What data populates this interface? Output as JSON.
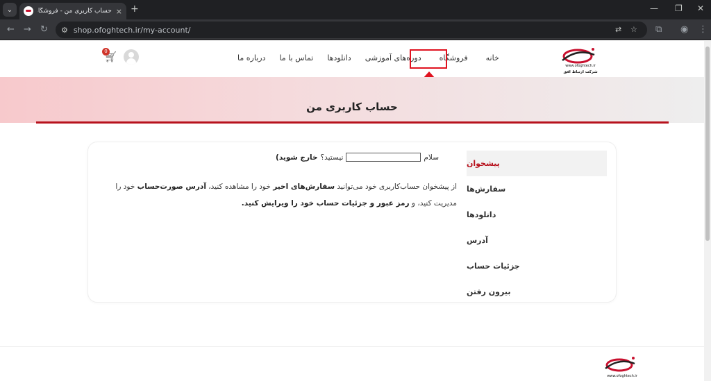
{
  "browser": {
    "tab_title": "حساب کاربری من - فروشگاه اینترنتی ار",
    "tab_close": "×",
    "new_tab": "+",
    "url": "shop.ofoghtech.ir/my-account/",
    "icons": [
      "back-icon",
      "forward-icon",
      "reload-icon",
      "site-info-icon",
      "translate-icon",
      "star-icon",
      "extensions-icon",
      "profile-icon",
      "menu-icon"
    ]
  },
  "header": {
    "nav": [
      {
        "label": "خانه"
      },
      {
        "label": "فروشگاه"
      },
      {
        "label": "دوره‌های آموزشی"
      },
      {
        "label": "دانلودها"
      },
      {
        "label": "تماس با ما"
      },
      {
        "label": "درباره ما"
      }
    ],
    "cart_count": "0",
    "logo_text": "www.ofoghtech.ir",
    "logo_subtext": "شرکت ارتباط افق"
  },
  "hero": {
    "title": "حساب کاربری من"
  },
  "account_menu": [
    {
      "label": "پیشخوان",
      "active": true
    },
    {
      "label": "سفارش‌ها",
      "active": false
    },
    {
      "label": "دانلودها",
      "active": false
    },
    {
      "label": "آدرس",
      "active": false
    },
    {
      "label": "جزئیات حساب",
      "active": false
    },
    {
      "label": "بیرون رفتن",
      "active": false
    }
  ],
  "dashboard": {
    "hello": "سلام",
    "not_you": "نیستید؟",
    "logout_link": "خارج شوید)",
    "desc_part1": "از پیشخوان حساب‌کاربری خود می‌توانید",
    "recent_orders": "سفارش‌های اخیر",
    "desc_part2": "خود را مشاهده کنید،",
    "billing_address": "آدرس صورت‌حساب",
    "desc_part3": "خود را مدیریت کنید، و",
    "edit_account": "رمز عبور و جزئیات حساب خود را ویرایش کنید."
  },
  "footer": {
    "logo_text": "www.ofoghtech.ir"
  },
  "colors": {
    "accent": "#b7121d",
    "highlight": "#e0121f"
  }
}
